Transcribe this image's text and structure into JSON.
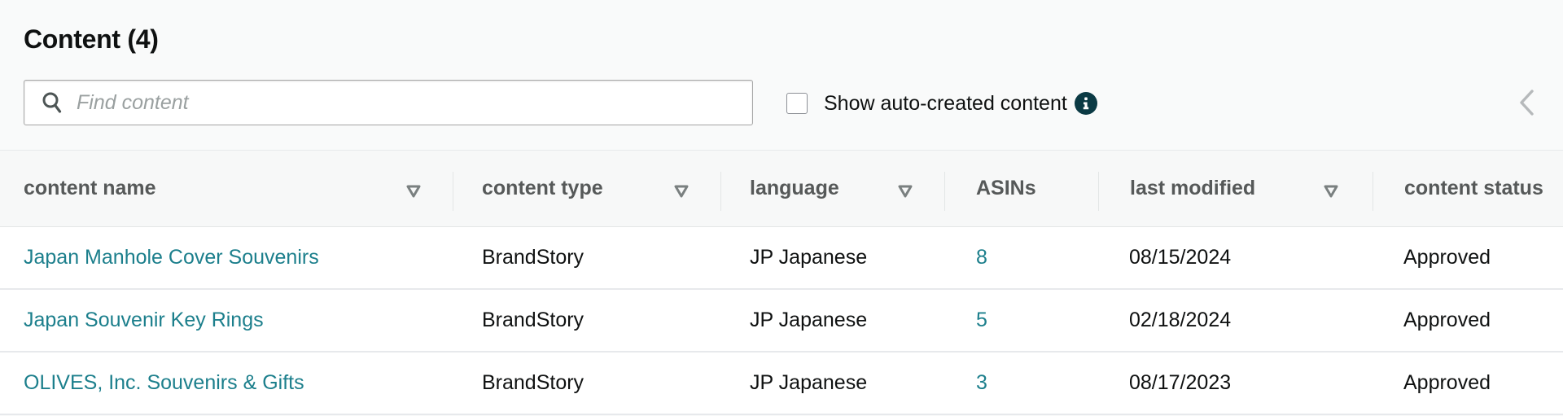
{
  "header": {
    "title": "Content (4)"
  },
  "search": {
    "placeholder": "Find content",
    "value": "",
    "icon": "search-icon"
  },
  "auto_created": {
    "label": "Show auto-created content",
    "checked": false,
    "info_icon": "info-icon"
  },
  "collapse": {
    "icon": "chevron-left-icon"
  },
  "table": {
    "columns": [
      {
        "label": "content name",
        "filterable": true
      },
      {
        "label": "content type",
        "filterable": true
      },
      {
        "label": "language",
        "filterable": true
      },
      {
        "label": "ASINs",
        "filterable": false
      },
      {
        "label": "last modified",
        "filterable": true
      },
      {
        "label": "content status",
        "filterable": false
      }
    ],
    "rows": [
      {
        "name": "Japan Manhole Cover Souvenirs",
        "type": "BrandStory",
        "language": "JP Japanese",
        "asins": "8",
        "last_modified": "08/15/2024",
        "status": "Approved"
      },
      {
        "name": "Japan Souvenir Key Rings",
        "type": "BrandStory",
        "language": "JP Japanese",
        "asins": "5",
        "last_modified": "02/18/2024",
        "status": "Approved"
      },
      {
        "name": "OLIVES, Inc. Souvenirs & Gifts",
        "type": "BrandStory",
        "language": "JP Japanese",
        "asins": "3",
        "last_modified": "08/17/2023",
        "status": "Approved"
      }
    ]
  },
  "colors": {
    "link": "#1c7f8c",
    "info_icon_bg": "#0b3a44",
    "header_text": "#565959",
    "page_bg": "#f9fafa"
  }
}
